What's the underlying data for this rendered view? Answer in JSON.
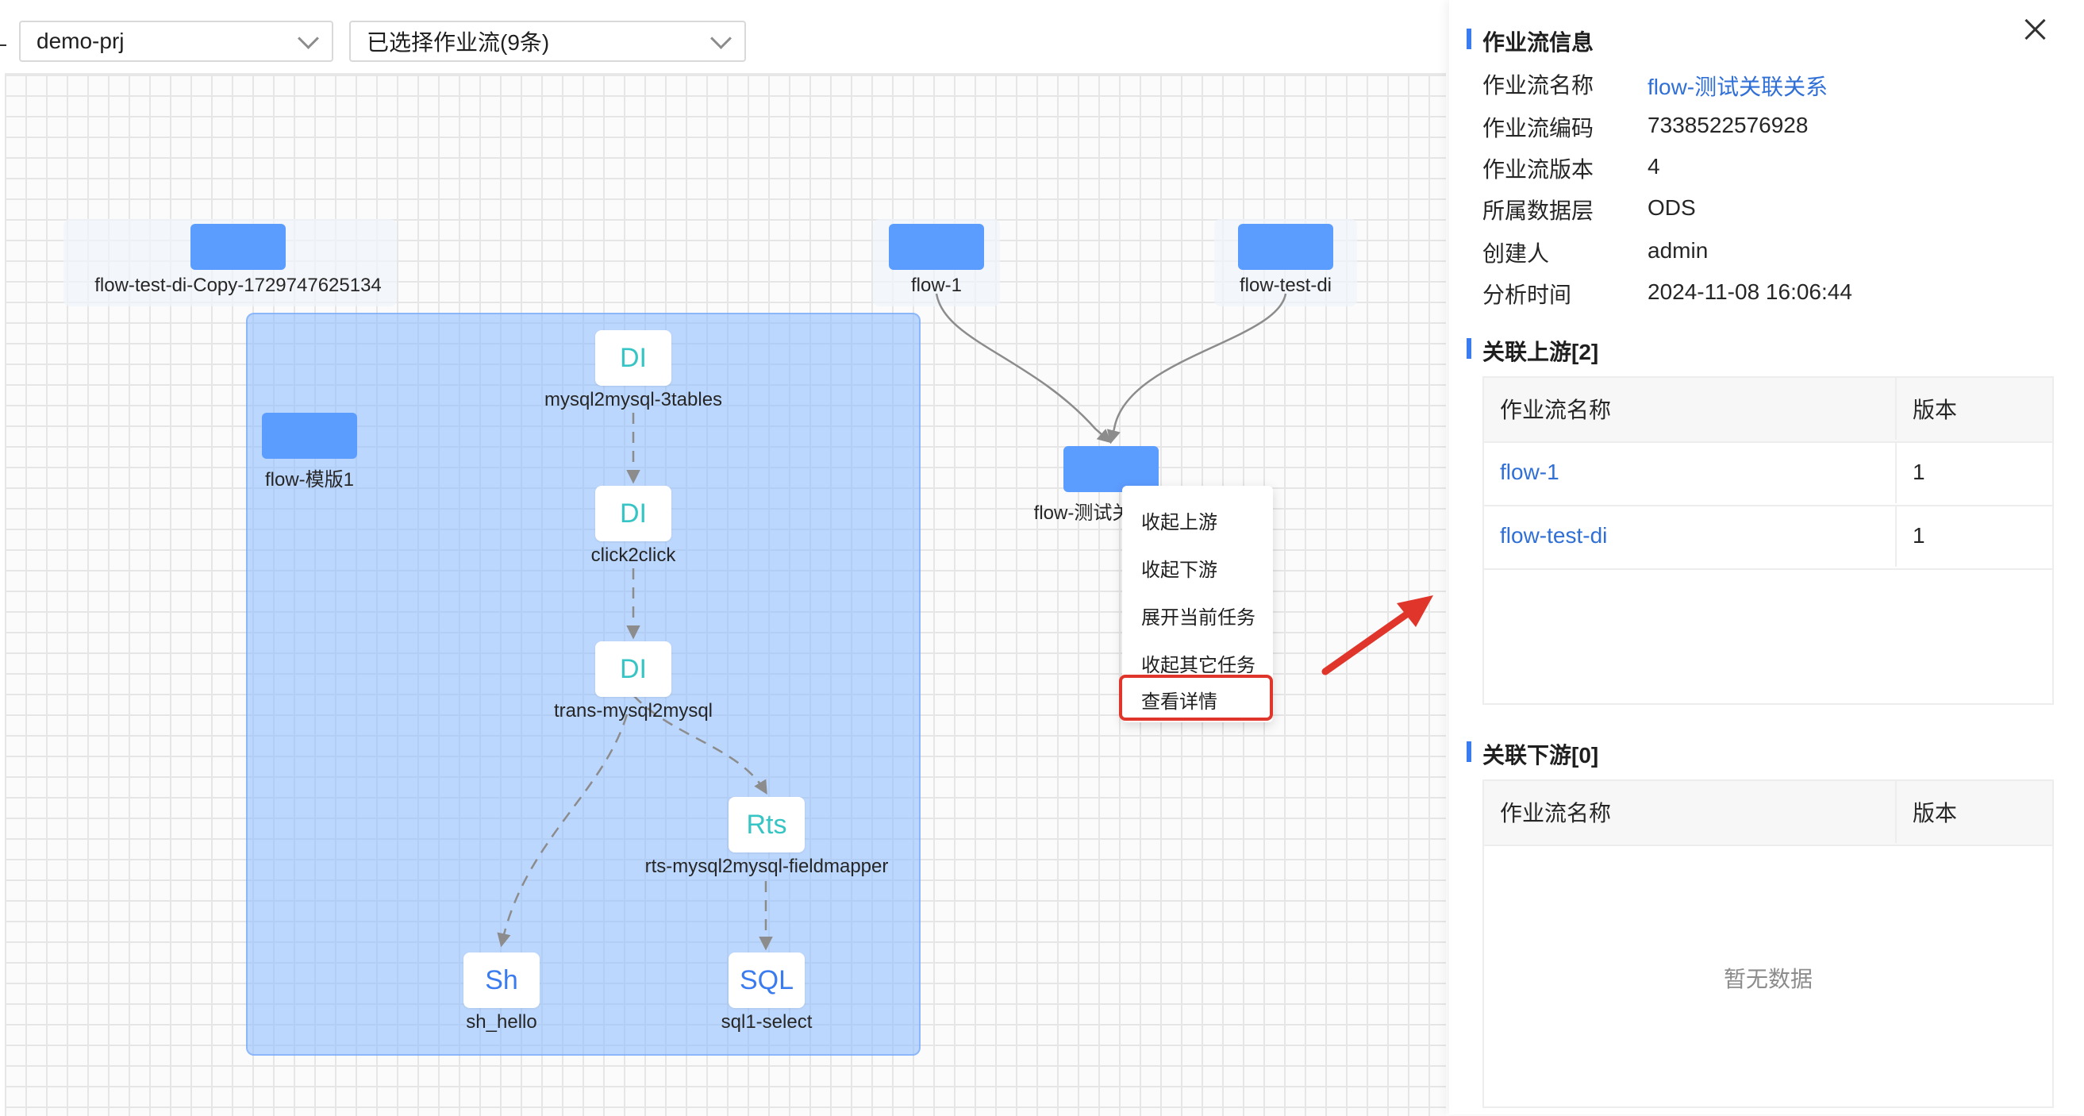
{
  "toolbar": {
    "project": "demo-prj",
    "flows": "已选择作业流(9条)"
  },
  "canvas": {
    "flows": {
      "copy": "flow-test-di-Copy-1729747625134",
      "flow1": "flow-1",
      "testdi": "flow-test-di",
      "template": "flow-模版1",
      "current": "flow-测试关联关系"
    },
    "tasks": {
      "t1": {
        "type": "DI",
        "name": "mysql2mysql-3tables"
      },
      "t2": {
        "type": "DI",
        "name": "click2click"
      },
      "t3": {
        "type": "DI",
        "name": "trans-mysql2mysql"
      },
      "t4": {
        "type": "Rts",
        "name": "rts-mysql2mysql-fieldmapper"
      },
      "t5": {
        "type": "Sh",
        "name": "sh_hello"
      },
      "t6": {
        "type": "SQL",
        "name": "sql1-select"
      }
    }
  },
  "context_menu": {
    "collapse_upstream": "收起上游",
    "collapse_downstream": "收起下游",
    "expand_current": "展开当前任务",
    "collapse_others": "收起其它任务",
    "view_details": "查看详情"
  },
  "panel": {
    "info_title": "作业流信息",
    "labels": {
      "name": "作业流名称",
      "code": "作业流编码",
      "version": "作业流版本",
      "layer": "所属数据层",
      "creator": "创建人",
      "time": "分析时间"
    },
    "values": {
      "name": "flow-测试关联关系",
      "code": "7338522576928",
      "version": "4",
      "layer": "ODS",
      "creator": "admin",
      "time": "2024-11-08 16:06:44"
    },
    "upstream": {
      "title": "关联上游[2]",
      "col_name": "作业流名称",
      "col_version": "版本",
      "rows": [
        {
          "name": "flow-1",
          "version": "1"
        },
        {
          "name": "flow-test-di",
          "version": "1"
        }
      ]
    },
    "downstream": {
      "title": "关联下游[0]",
      "col_name": "作业流名称",
      "col_version": "版本",
      "empty": "暂无数据"
    }
  },
  "colors": {
    "flow_node": "#5b9cff",
    "group_bg": "#89b9ff",
    "link": "#2f6fd6",
    "highlight": "#e0352b",
    "task_text": "#36c4c4"
  }
}
